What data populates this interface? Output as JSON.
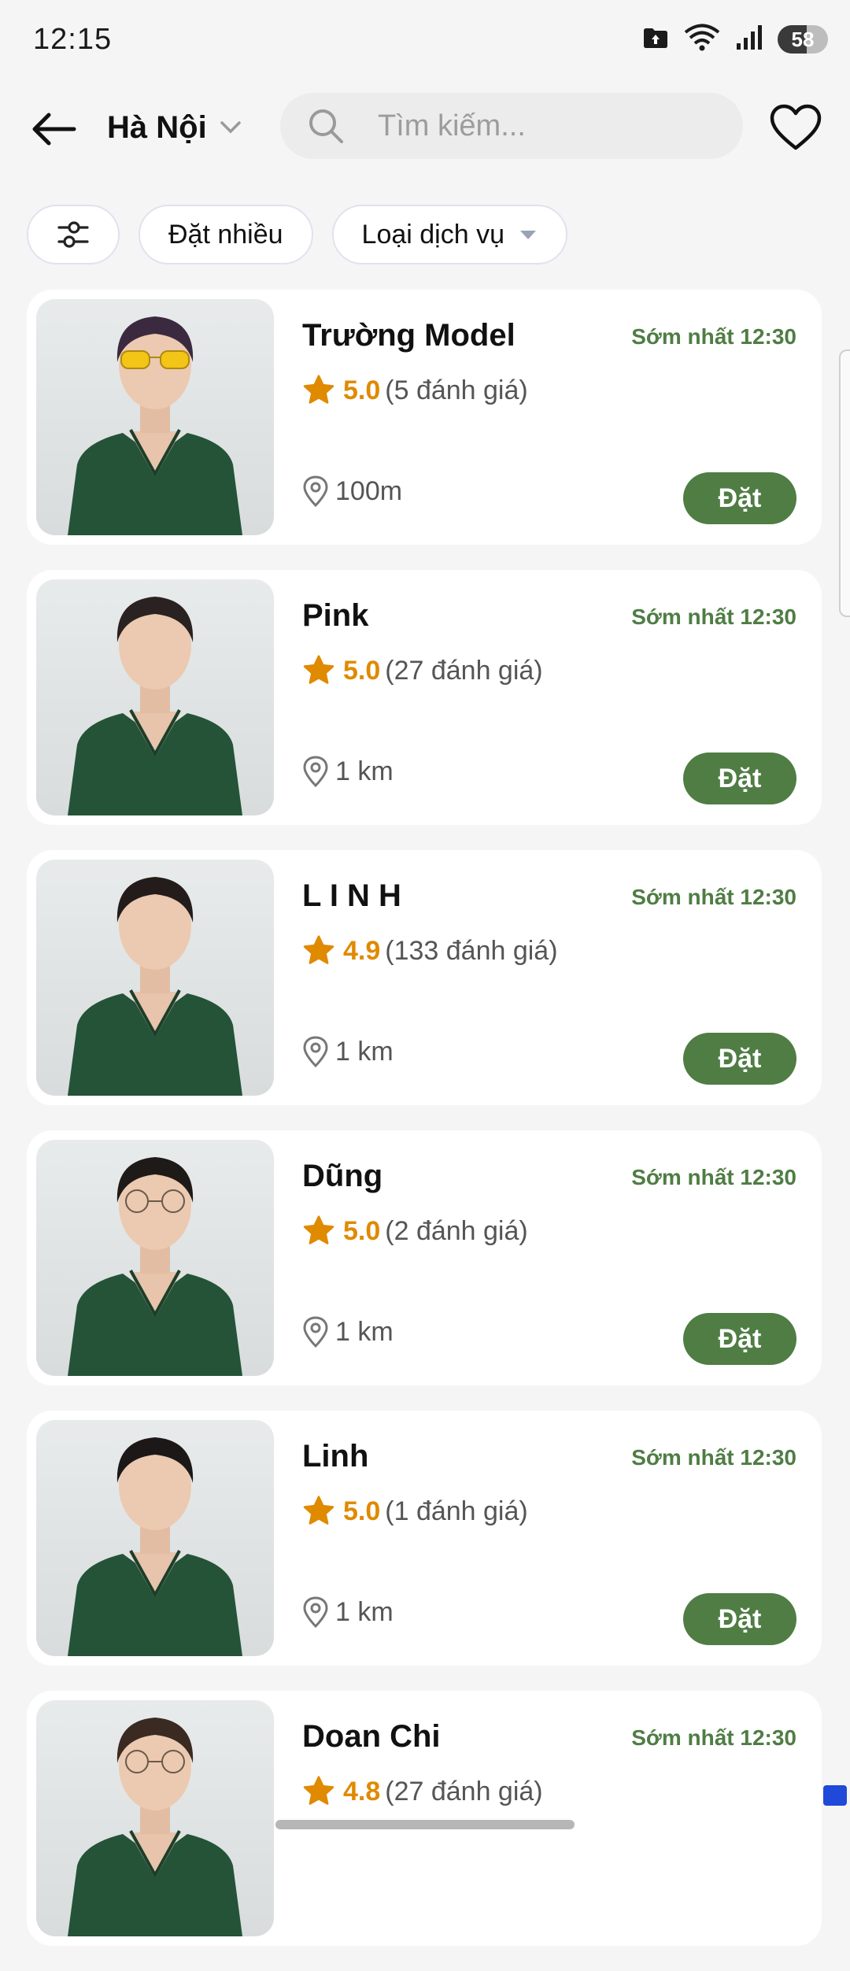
{
  "status_bar": {
    "time": "12:15",
    "battery_level": "58",
    "battery_fraction": 0.58
  },
  "header": {
    "city": "Hà Nội",
    "search_placeholder": "Tìm kiếm..."
  },
  "filters": {
    "popular_label": "Đặt nhiều",
    "service_type_label": "Loại dịch vụ"
  },
  "providers": [
    {
      "name": "Trường Model",
      "earliest": "Sớm nhất 12:30",
      "rating": "5.0",
      "reviews": "(5 đánh giá)",
      "distance": "100m",
      "book_label": "Đặt",
      "hair_color": "#3b2a3f",
      "glasses": "yellow"
    },
    {
      "name": "Pink",
      "earliest": "Sớm nhất 12:30",
      "rating": "5.0",
      "reviews": "(27 đánh giá)",
      "distance": "1 km",
      "book_label": "Đặt",
      "hair_color": "#2a2220",
      "glasses": "none"
    },
    {
      "name": "L I N H",
      "earliest": "Sớm nhất 12:30",
      "rating": "4.9",
      "reviews": "(133 đánh giá)",
      "distance": "1 km",
      "book_label": "Đặt",
      "hair_color": "#231c1a",
      "glasses": "none"
    },
    {
      "name": "Dũng",
      "earliest": "Sớm nhất 12:30",
      "rating": "5.0",
      "reviews": "(2 đánh giá)",
      "distance": "1 km",
      "book_label": "Đặt",
      "hair_color": "#1e1a18",
      "glasses": "clear"
    },
    {
      "name": "Linh",
      "earliest": "Sớm nhất 12:30",
      "rating": "5.0",
      "reviews": "(1 đánh giá)",
      "distance": "1 km",
      "book_label": "Đặt",
      "hair_color": "#1c1817",
      "glasses": "none"
    },
    {
      "name": "Doan Chi",
      "earliest": "Sớm nhất 12:30",
      "rating": "4.8",
      "reviews": "(27 đánh giá)",
      "distance": "",
      "book_label": "",
      "hair_color": "#3a2a22",
      "glasses": "clear"
    }
  ],
  "colors": {
    "accent": "#4f7d44",
    "rating": "#e08a00",
    "uniform": "#245338",
    "background": "#f5f5f5"
  }
}
